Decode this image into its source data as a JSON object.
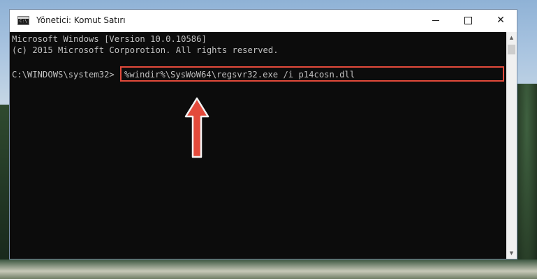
{
  "window": {
    "title": "Yönetici: Komut Satırı",
    "minimize_glyph": "",
    "close_glyph": "✕"
  },
  "console": {
    "line1": "Microsoft Windows [Version 10.0.10586]",
    "line2": "(c) 2015 Microsoft Corporotion. All rights reserved.",
    "prompt": "C:\\WINDOWS\\system32>",
    "command": "%windir%\\SysWoW64\\regsvr32.exe /i p14cosn.dll"
  },
  "icons": {
    "app": "cmd-console-icon",
    "annotation": "red-arrow-up-icon"
  },
  "colors": {
    "console_bg": "#0c0c0c",
    "console_text": "#c0c0c0",
    "highlight": "#e34a3b"
  }
}
